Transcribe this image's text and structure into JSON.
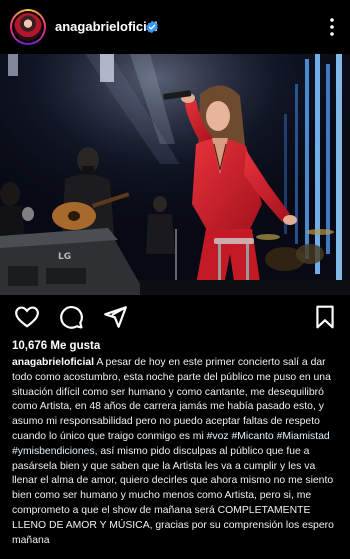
{
  "post": {
    "username": "anagabrieloficial",
    "verified": true,
    "likes_text": "10,676 Me gusta"
  },
  "caption": {
    "username": "anagabrieloficial",
    "part1": " A pesar de hoy en este primer concierto salí a dar todo como acostumbro, esta noche parte del público me puso en una situación difícil como ser humano y como cantante, me desequilibró como Artista, en 48 años de carrera jamás me había pasado esto, y asumo mi responsabilidad pero no puedo aceptar faltas de respeto cuando lo único que traigo conmigo es mi ",
    "hashtag1": "#voz",
    "part2": " ",
    "hashtag2": "#Micanto",
    "part3": " ",
    "hashtag3": "#Miamistad",
    "part4": " ",
    "hashtag4": "#ymisbendiciones",
    "part5": ", así mismo pido disculpas al público que fue a pasársela bien y que saben que la Artista les va a cumplir y les va llenar el alma de amor, quiero decirles que ahora mismo no me siento bien como ser humano y mucho menos como Artista, pero si, me comprometo a que el show de mañana será COMPLETAMENTE LLENO DE AMOR Y MÚSICA, gracias por su comprensión los espero mañana"
  },
  "photo": {
    "stage_sign": "LG"
  },
  "colors": {
    "background": "#000000",
    "suit_red": "#d51f2b",
    "verified_blue": "#3897f0",
    "stage_light": "#6fb6ff"
  },
  "icons": [
    "heart-icon",
    "comment-icon",
    "share-icon",
    "bookmark-icon",
    "more-options-icon",
    "verified-badge-icon"
  ]
}
